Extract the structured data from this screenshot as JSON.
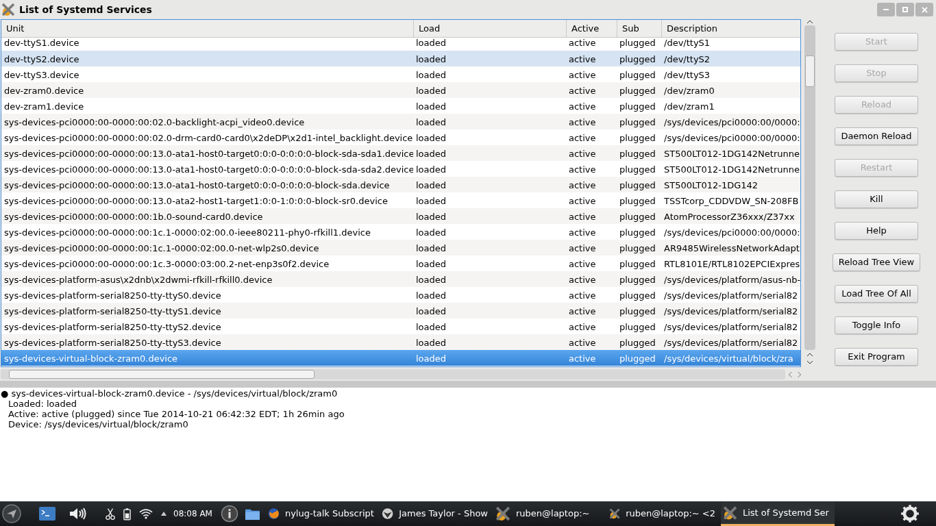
{
  "window": {
    "title": "List of Systemd Services"
  },
  "table": {
    "columns": [
      "Unit",
      "Load",
      "Active",
      "Sub",
      "Description"
    ],
    "rows": [
      {
        "cells": [
          "dev-ttyS1.device",
          "loaded",
          "active",
          "plugged",
          "/dev/ttyS1"
        ],
        "hovered": false,
        "selected": false
      },
      {
        "cells": [
          "dev-ttyS2.device",
          "loaded",
          "active",
          "plugged",
          "/dev/ttyS2"
        ],
        "hovered": true,
        "selected": false
      },
      {
        "cells": [
          "dev-ttyS3.device",
          "loaded",
          "active",
          "plugged",
          "/dev/ttyS3"
        ],
        "hovered": false,
        "selected": false
      },
      {
        "cells": [
          "dev-zram0.device",
          "loaded",
          "active",
          "plugged",
          "/dev/zram0"
        ],
        "hovered": false,
        "selected": false
      },
      {
        "cells": [
          "dev-zram1.device",
          "loaded",
          "active",
          "plugged",
          "/dev/zram1"
        ],
        "hovered": false,
        "selected": false
      },
      {
        "cells": [
          "sys-devices-pci0000:00-0000:00:02.0-backlight-acpi_video0.device",
          "loaded",
          "active",
          "plugged",
          "/sys/devices/pci0000:00/0000:"
        ],
        "hovered": false,
        "selected": false
      },
      {
        "cells": [
          "sys-devices-pci0000:00-0000:00:02.0-drm-card0-card0\\x2deDP\\x2d1-intel_backlight.device",
          "loaded",
          "active",
          "plugged",
          "/sys/devices/pci0000:00/0000:"
        ],
        "hovered": false,
        "selected": false
      },
      {
        "cells": [
          "sys-devices-pci0000:00-0000:00:13.0-ata1-host0-target0:0:0-0:0:0:0-block-sda-sda1.device",
          "loaded",
          "active",
          "plugged",
          "ST500LT012-1DG142Netrunne"
        ],
        "hovered": false,
        "selected": false
      },
      {
        "cells": [
          "sys-devices-pci0000:00-0000:00:13.0-ata1-host0-target0:0:0-0:0:0:0-block-sda-sda2.device",
          "loaded",
          "active",
          "plugged",
          "ST500LT012-1DG142Netrunne"
        ],
        "hovered": false,
        "selected": false
      },
      {
        "cells": [
          "sys-devices-pci0000:00-0000:00:13.0-ata1-host0-target0:0:0-0:0:0:0-block-sda.device",
          "loaded",
          "active",
          "plugged",
          "ST500LT012-1DG142"
        ],
        "hovered": false,
        "selected": false
      },
      {
        "cells": [
          "sys-devices-pci0000:00-0000:00:13.0-ata2-host1-target1:0:0-1:0:0:0-block-sr0.device",
          "loaded",
          "active",
          "plugged",
          "TSSTcorp_CDDVDW_SN-208FB"
        ],
        "hovered": false,
        "selected": false
      },
      {
        "cells": [
          "sys-devices-pci0000:00-0000:00:1b.0-sound-card0.device",
          "loaded",
          "active",
          "plugged",
          "AtomProcessorZ36xxx/Z37xx"
        ],
        "hovered": false,
        "selected": false
      },
      {
        "cells": [
          "sys-devices-pci0000:00-0000:00:1c.1-0000:02:00.0-ieee80211-phy0-rfkill1.device",
          "loaded",
          "active",
          "plugged",
          "/sys/devices/pci0000:00/0000:"
        ],
        "hovered": false,
        "selected": false
      },
      {
        "cells": [
          "sys-devices-pci0000:00-0000:00:1c.1-0000:02:00.0-net-wlp2s0.device",
          "loaded",
          "active",
          "plugged",
          "AR9485WirelessNetworkAdapt"
        ],
        "hovered": false,
        "selected": false
      },
      {
        "cells": [
          "sys-devices-pci0000:00-0000:00:1c.3-0000:03:00.2-net-enp3s0f2.device",
          "loaded",
          "active",
          "plugged",
          "RTL8101E/RTL8102EPCIExpres"
        ],
        "hovered": false,
        "selected": false
      },
      {
        "cells": [
          "sys-devices-platform-asus\\x2dnb\\x2dwmi-rfkill-rfkill0.device",
          "loaded",
          "active",
          "plugged",
          "/sys/devices/platform/asus-nb-"
        ],
        "hovered": false,
        "selected": false
      },
      {
        "cells": [
          "sys-devices-platform-serial8250-tty-ttyS0.device",
          "loaded",
          "active",
          "plugged",
          "/sys/devices/platform/serial82"
        ],
        "hovered": false,
        "selected": false
      },
      {
        "cells": [
          "sys-devices-platform-serial8250-tty-ttyS1.device",
          "loaded",
          "active",
          "plugged",
          "/sys/devices/platform/serial82"
        ],
        "hovered": false,
        "selected": false
      },
      {
        "cells": [
          "sys-devices-platform-serial8250-tty-ttyS2.device",
          "loaded",
          "active",
          "plugged",
          "/sys/devices/platform/serial82"
        ],
        "hovered": false,
        "selected": false
      },
      {
        "cells": [
          "sys-devices-platform-serial8250-tty-ttyS3.device",
          "loaded",
          "active",
          "plugged",
          "/sys/devices/platform/serial82"
        ],
        "hovered": false,
        "selected": false
      },
      {
        "cells": [
          "sys-devices-virtual-block-zram0.device",
          "loaded",
          "active",
          "plugged",
          "/sys/devices/virtual/block/zra"
        ],
        "hovered": false,
        "selected": true
      }
    ]
  },
  "buttons": [
    {
      "label": "Start",
      "disabled": true
    },
    {
      "label": "Stop",
      "disabled": true
    },
    {
      "label": "Reload",
      "disabled": true
    },
    {
      "label": "Daemon Reload",
      "disabled": false
    },
    {
      "label": "Restart",
      "disabled": true
    },
    {
      "label": "Kill",
      "disabled": false
    },
    {
      "label": "Help",
      "disabled": false
    },
    {
      "label": "Reload Tree View",
      "disabled": false
    },
    {
      "label": "Load Tree Of All",
      "disabled": false
    },
    {
      "label": "Toggle Info",
      "disabled": false
    },
    {
      "label": "Exit Program",
      "disabled": false
    }
  ],
  "info": [
    "● sys-devices-virtual-block-zram0.device - /sys/devices/virtual/block/zram0",
    "Loaded: loaded",
    "Active: active (plugged) since Tue 2014-10-21 06:42:32 EDT; 1h 26min ago",
    "Device: /sys/devices/virtual/block/zram0"
  ],
  "taskbar": {
    "clock": "08:08 AM",
    "tasks": [
      {
        "kind": "firefox",
        "label": "nylug-talk Subscript",
        "selected": false
      },
      {
        "kind": "globe",
        "label": "James Taylor - Show",
        "selected": false
      },
      {
        "kind": "x",
        "label": "ruben@laptop:~",
        "selected": false
      },
      {
        "kind": "x",
        "label": "ruben@laptop:~ <2",
        "selected": false
      },
      {
        "kind": "x",
        "label": "List of Systemd Ser",
        "selected": true
      }
    ]
  }
}
